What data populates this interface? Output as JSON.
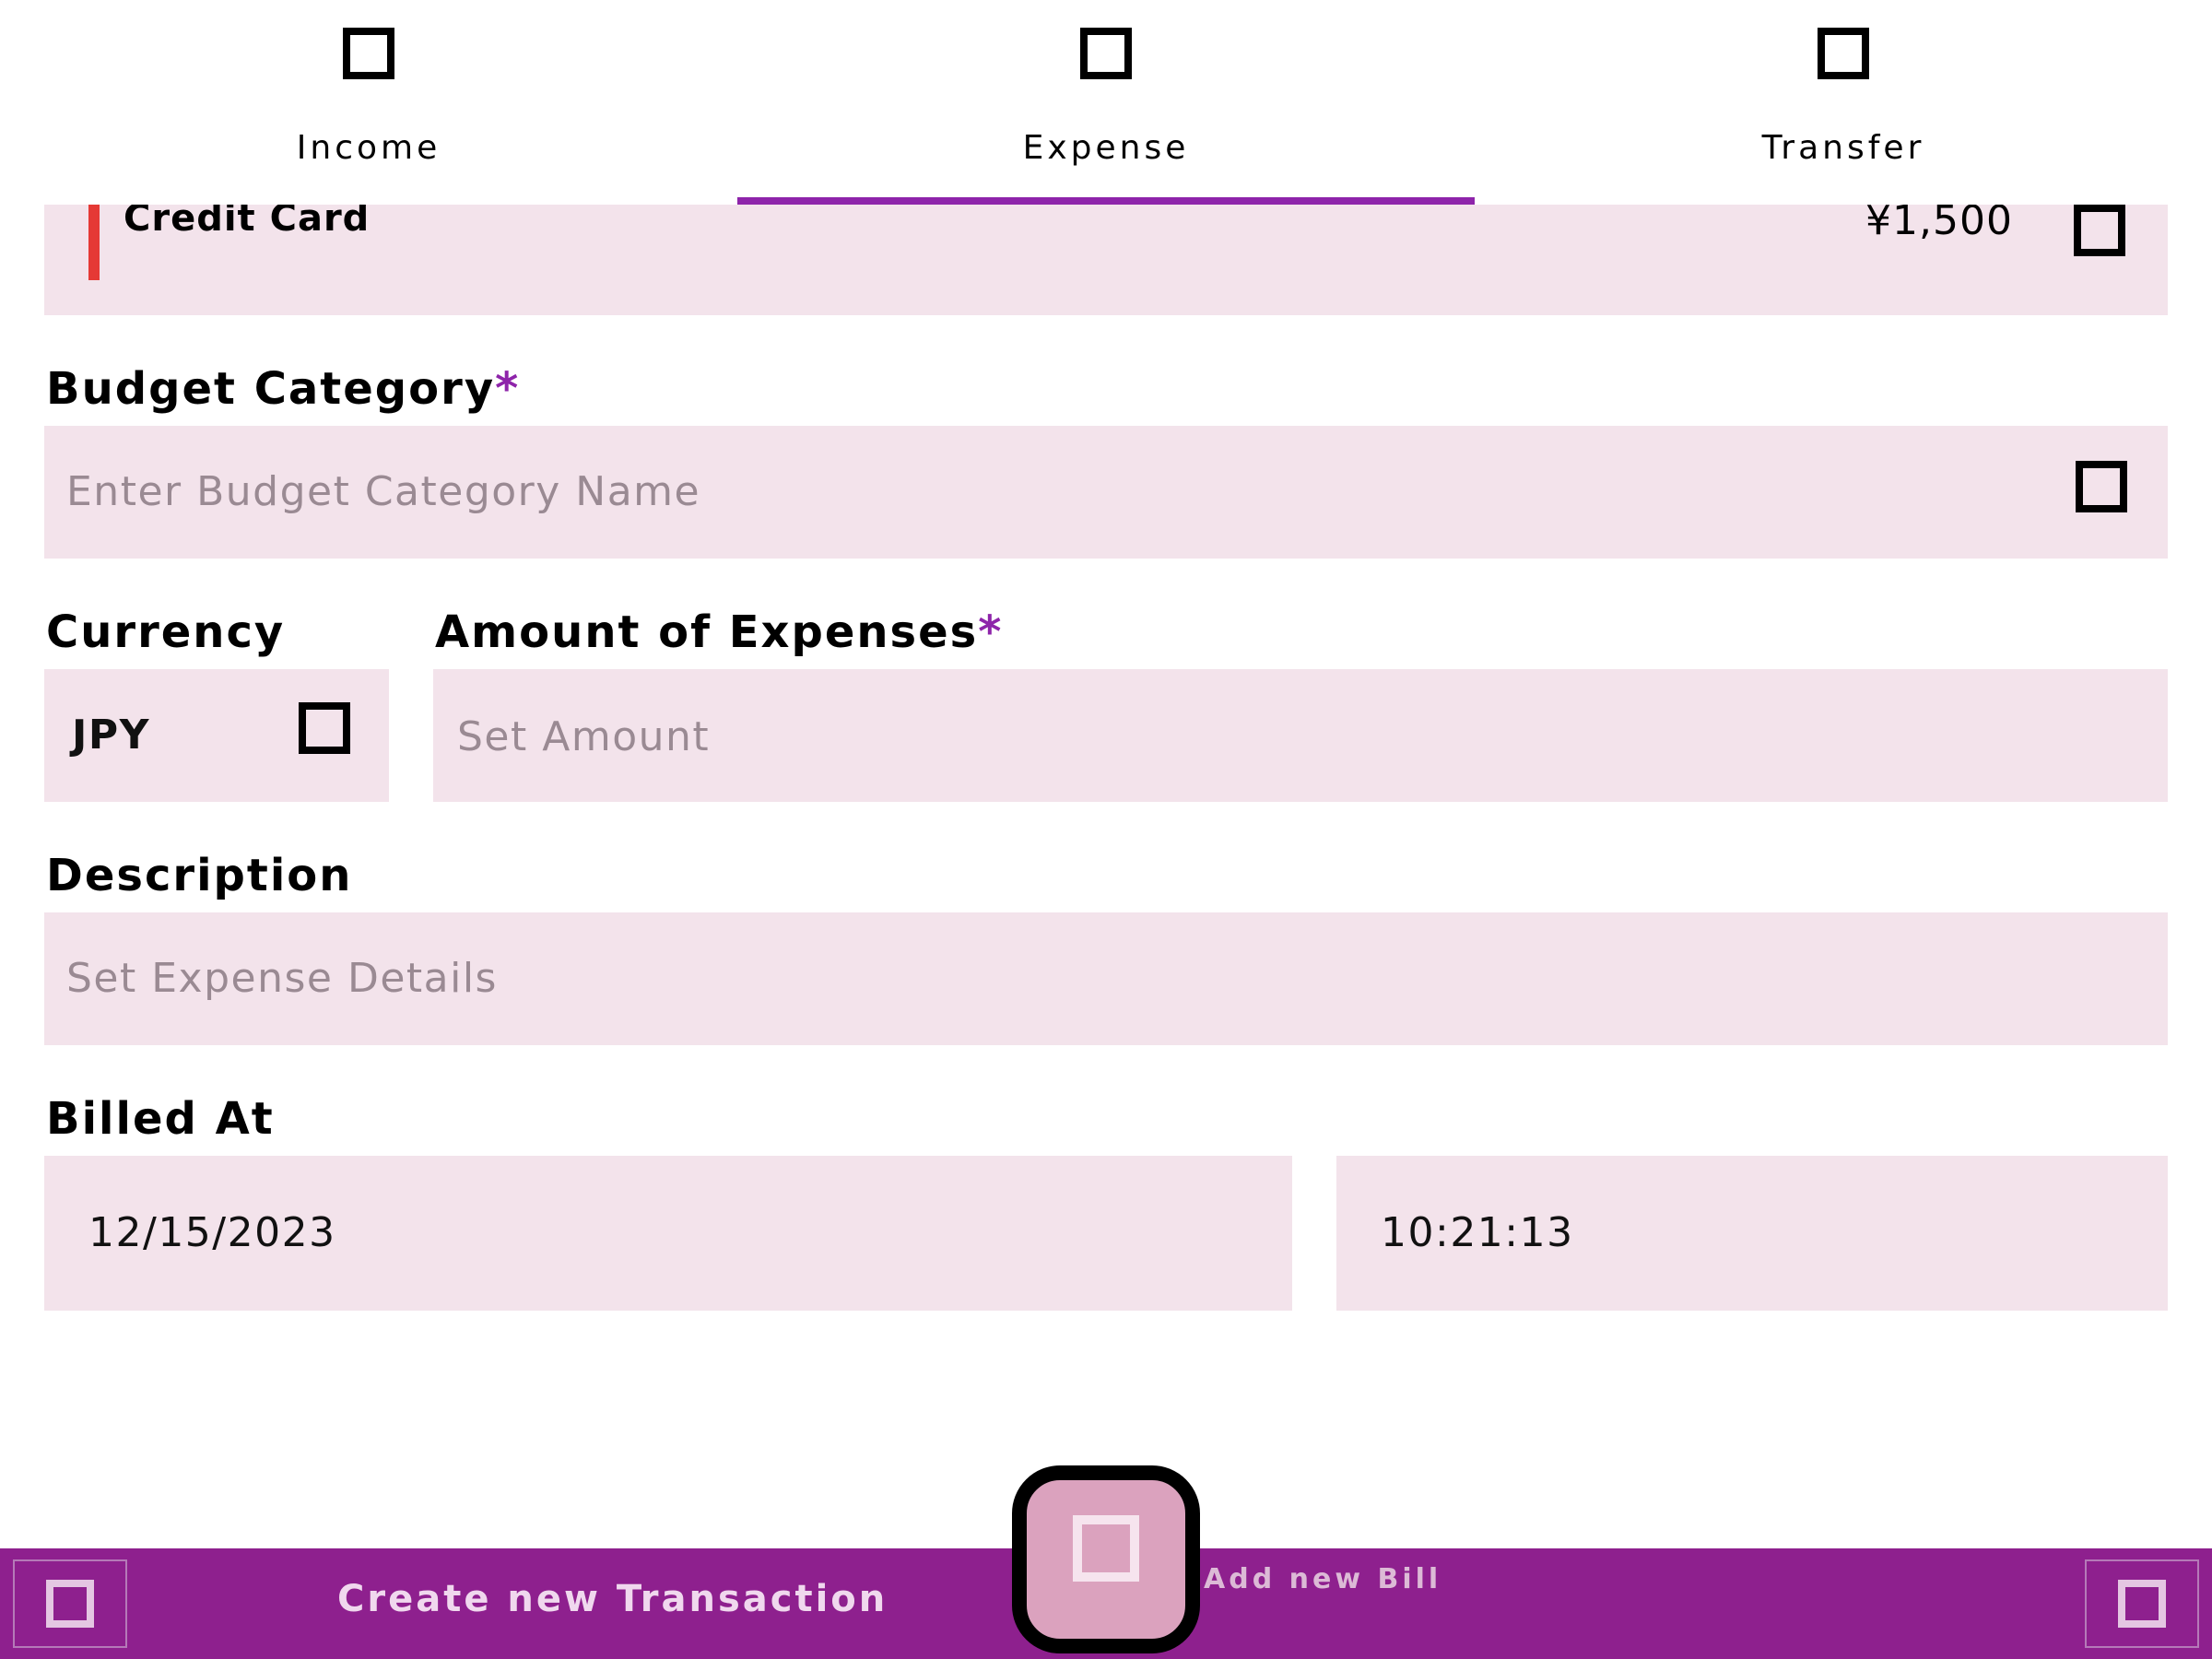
{
  "tabs": [
    {
      "label": "Income",
      "icon": "income-icon",
      "selected": false
    },
    {
      "label": "Expense",
      "icon": "expense-icon",
      "selected": true
    },
    {
      "label": "Transfer",
      "icon": "transfer-icon",
      "selected": false
    }
  ],
  "account": {
    "name": "Credit Card",
    "balance": "¥1,500",
    "accent_color": "#e53935"
  },
  "form": {
    "budget_category": {
      "label": "Budget Category",
      "required_mark": "*",
      "placeholder": "Enter Budget Category Name"
    },
    "currency": {
      "label": "Currency",
      "value": "JPY"
    },
    "amount": {
      "label": "Amount of Expenses",
      "required_mark": "*",
      "placeholder": "Set Amount"
    },
    "description": {
      "label": "Description",
      "placeholder": "Set Expense Details"
    },
    "billed_at": {
      "label": "Billed At",
      "date": "12/15/2023",
      "time": "10:21:13"
    }
  },
  "bottom_bar": {
    "create_label": "Create new Transaction",
    "add_bill_label": "Add new Bill"
  },
  "colors": {
    "accent": "#8e24aa",
    "field_background": "#f3e3eb",
    "bottom_bar": "#8e208e",
    "fab": "#dba2be"
  }
}
